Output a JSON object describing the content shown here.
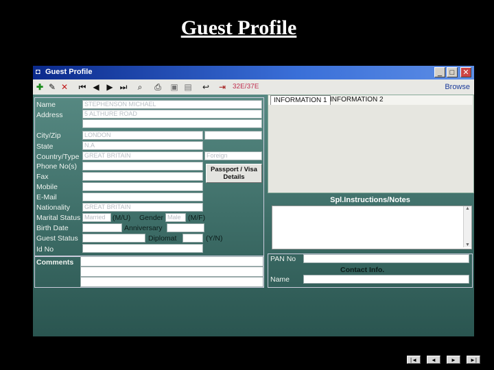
{
  "slide_title": "Guest Profile",
  "window": {
    "title": "Guest Profile",
    "counter": "32E/37E",
    "browse_label": "Browse",
    "minimize": "_",
    "maximize": "□",
    "close": "✕"
  },
  "toolbar_icons": [
    "add-icon",
    "edit-icon",
    "delete-icon",
    "first-record-icon",
    "previous-record-icon",
    "next-record-icon",
    "last-record-icon",
    "find-icon",
    "print-icon",
    "save-icon",
    "save-all-icon",
    "undo-icon",
    "exit-icon"
  ],
  "form": {
    "labels": {
      "name": "Name",
      "address": "Address",
      "city_zip": "City/Zip",
      "state": "State",
      "country_type": "Country/Type",
      "phone": "Phone No(s)",
      "fax": "Fax",
      "mobile": "Mobile",
      "email": "E-Mail",
      "nationality": "Nationality",
      "marital_status": "Marital Status",
      "marital_hint": "(M/U)",
      "gender": "Gender",
      "gender_hint": "(M/F)",
      "birth_date": "Birth Date",
      "anniversary": "Anniversary",
      "guest_status": "Guest Status",
      "diplomat": "Diplomat",
      "diplomat_hint": "(Y/N)",
      "id_no": "Id No",
      "comments": "Comments",
      "pan_no": "PAN No",
      "contact_info": "Contact Info.",
      "contact_name": "Name"
    },
    "values": {
      "name": "STEPHENSON MICHAEL",
      "address": "5 ALTHURE ROAD",
      "city": "LONDON",
      "state": "N.A",
      "country": "GREAT BRITAIN",
      "type": "Foreign",
      "nationality": "GREAT BRITAIN",
      "marital_status": "Married",
      "gender": "Male"
    },
    "passport_button": "Passport / Visa Details"
  },
  "tabs": [
    "INFORMATION 1",
    "INFORMATION 2"
  ],
  "notes_title": "Spl.Instructions/Notes",
  "slide_nav": [
    "|◄",
    "◄",
    "►",
    "►|"
  ]
}
